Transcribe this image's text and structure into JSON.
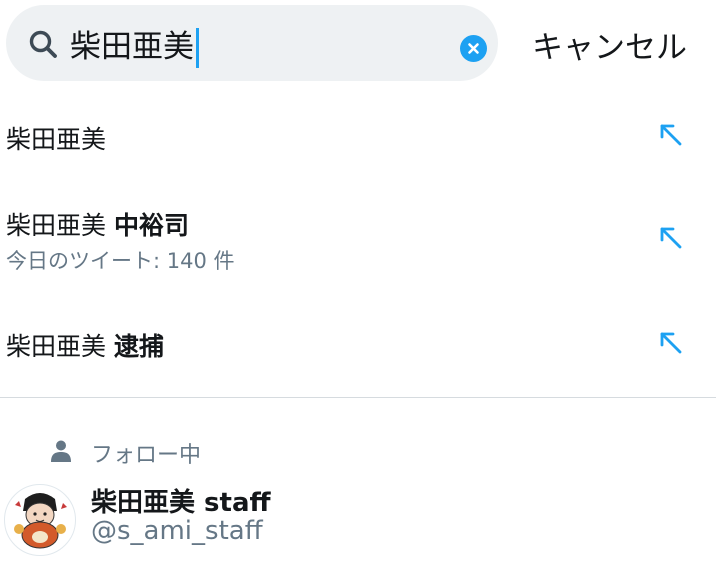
{
  "search": {
    "query": "柴田亜美",
    "cancel_label": "キャンセル"
  },
  "suggestions": [
    {
      "plain": "柴田亜美",
      "bold": "",
      "subtitle": ""
    },
    {
      "plain": "柴田亜美 ",
      "bold": "中裕司",
      "subtitle": "今日のツイート: 140 件"
    },
    {
      "plain": "柴田亜美 ",
      "bold": "逮捕",
      "subtitle": ""
    }
  ],
  "following": {
    "label": "フォロー中",
    "user": {
      "name": "柴田亜美 staff",
      "handle": "@s_ami_staff"
    }
  },
  "colors": {
    "accent": "#1da1f2",
    "secondary_text": "#657786",
    "search_bg": "#eef1f3"
  }
}
